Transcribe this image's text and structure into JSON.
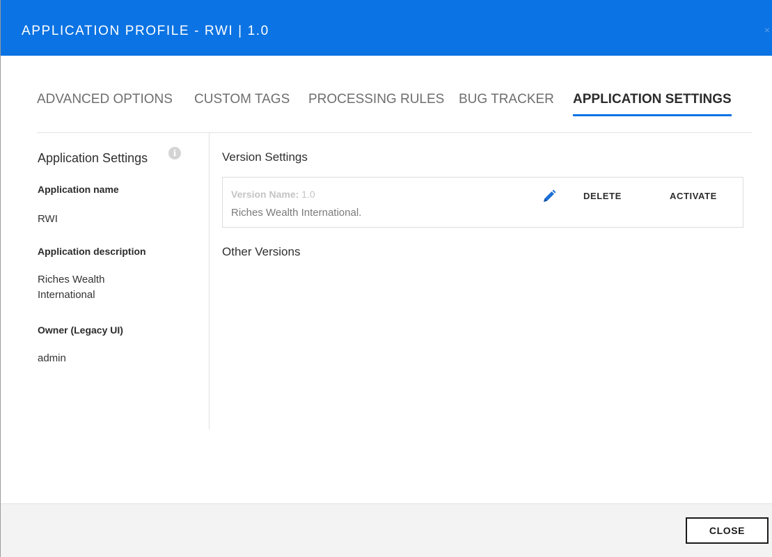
{
  "header": {
    "title": "APPLICATION PROFILE - RWI | 1.0",
    "close_glyph": "×"
  },
  "tabs": [
    {
      "label": "ADVANCED OPTIONS",
      "active": false
    },
    {
      "label": "CUSTOM TAGS",
      "active": false
    },
    {
      "label": "PROCESSING RULES",
      "active": false
    },
    {
      "label": "BUG TRACKER",
      "active": false
    },
    {
      "label": "APPLICATION SETTINGS",
      "active": true
    }
  ],
  "sidebar": {
    "title": "Application Settings",
    "info_glyph": "i",
    "fields": [
      {
        "label": "Application name",
        "value": "RWI"
      },
      {
        "label": "Application description",
        "value": "Riches Wealth International"
      },
      {
        "label": "Owner (Legacy UI)",
        "value": "admin"
      }
    ]
  },
  "main": {
    "version_settings_title": "Version Settings",
    "version": {
      "name_label": "Version Name:",
      "name_value": "1.0",
      "description": "Riches Wealth International.",
      "delete_label": "DELETE",
      "activate_label": "ACTIVATE"
    },
    "other_versions_title": "Other Versions"
  },
  "footer": {
    "close_label": "CLOSE"
  },
  "colors": {
    "header_bg": "#0b73e3",
    "accent": "#0b73e3",
    "footer_bg": "#f3f3f3"
  },
  "icons": {
    "info": "info-icon",
    "edit": "pencil-icon",
    "close": "close-icon"
  }
}
